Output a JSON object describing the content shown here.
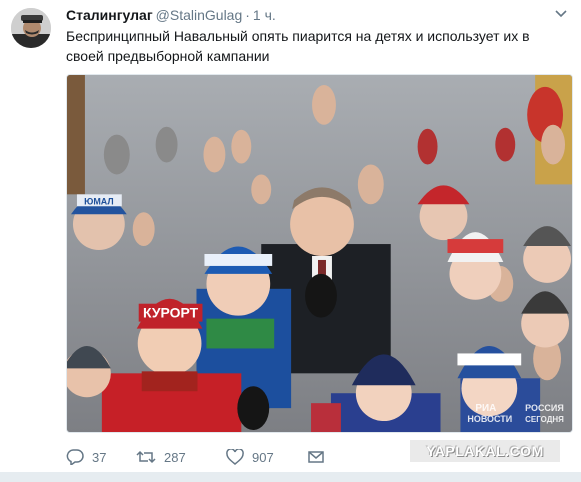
{
  "tweet": {
    "author_name": "Сталингулаг",
    "author_handle": "@StalinGulag",
    "separator": "·",
    "time": "1 ч.",
    "text": "Беспринципный Навальный опять пиарится на детях и использует их в своей предвыборной кампании",
    "photo": {
      "overlay_brand_line1": "РИА",
      "overlay_brand_line2": "НОВОСТИ",
      "overlay_brand2_line1": "РОССИЯ",
      "overlay_brand2_line2": "СЕГОДНЯ",
      "hat_text_1": "ЮМАЛ",
      "hat_text_2": "КУРОРТ"
    }
  },
  "actions": {
    "reply_count": "37",
    "retweet_count": "287",
    "like_count": "907"
  },
  "watermark": "YAPLAKAL.COM",
  "colors": {
    "text_primary": "#14171a",
    "text_secondary": "#657786",
    "border": "#e1e8ed",
    "background_strip": "#e6ecf0"
  },
  "icons": [
    "caret-down-icon",
    "reply-icon",
    "retweet-icon",
    "heart-icon",
    "envelope-icon"
  ]
}
